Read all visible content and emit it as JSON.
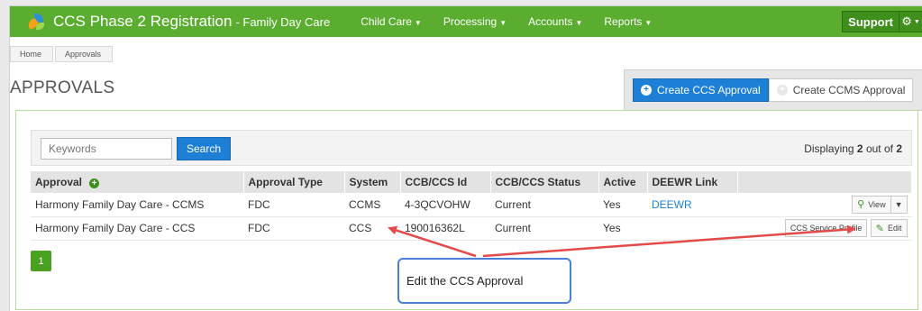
{
  "navbar": {
    "title": "CCS Phase 2 Registration",
    "subtitle": "- Family Day Care",
    "menu": [
      {
        "label": "Child Care"
      },
      {
        "label": "Processing"
      },
      {
        "label": "Accounts"
      },
      {
        "label": "Reports"
      }
    ],
    "support_label": "Support",
    "brand_color": "#5aad2e"
  },
  "breadcrumb": [
    "Home",
    "Approvals"
  ],
  "page_title": "APPROVALS",
  "create_buttons": {
    "ccs": "Create CCS Approval",
    "ccms": "Create CCMS Approval"
  },
  "search": {
    "placeholder": "Keywords",
    "button": "Search",
    "displaying_prefix": "Displaying ",
    "displaying_count": "2",
    "displaying_mid": " out of ",
    "displaying_total": "2"
  },
  "table": {
    "headers": [
      "Approval",
      "Approval Type",
      "System",
      "CCB/CCS Id",
      "CCB/CCS Status",
      "Active",
      "DEEWR Link"
    ],
    "rows": [
      {
        "approval": "Harmony Family Day Care - CCMS",
        "type": "FDC",
        "system": "CCMS",
        "id": "4-3QCVOHW",
        "status": "Current",
        "active": "Yes",
        "deewr": "DEEWR"
      },
      {
        "approval": "Harmony Family Day Care - CCS",
        "type": "FDC",
        "system": "CCS",
        "id": "190016362L",
        "status": "Current",
        "active": "Yes",
        "deewr": ""
      }
    ],
    "view_label": "View",
    "ccs_profile_label": "CCS Service Profile",
    "edit_label": "Edit"
  },
  "pager": {
    "current": "1"
  },
  "callout": "Edit the CCS Approval",
  "colors": {
    "primary": "#1e7fd6",
    "green": "#4aa11f",
    "arrow": "#e34a4a",
    "callout_border": "#4a7fd8"
  }
}
